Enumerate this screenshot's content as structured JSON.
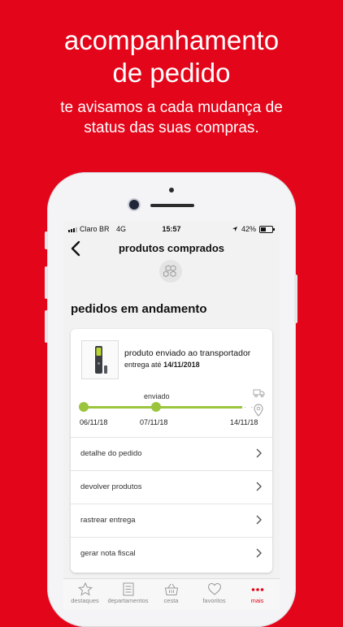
{
  "promo": {
    "headline_line1": "acompanhamento",
    "headline_line2": "de pedido",
    "sub_line1": "te avisamos a cada mudança de",
    "sub_line2": "status das suas compras."
  },
  "statusbar": {
    "carrier": "Claro BR",
    "network": "4G",
    "time": "15:57",
    "battery": "42%"
  },
  "navbar": {
    "back_icon": "chevron-left-icon",
    "title": "produtos comprados",
    "header_icon": "boxes-icon"
  },
  "section": {
    "title": "pedidos em andamento"
  },
  "order": {
    "status": "produto enviado ao transportador",
    "eta_prefix": "entrega até",
    "eta_date": "14/11/2018",
    "timeline": {
      "current_label": "enviado",
      "dates": [
        "06/11/18",
        "07/11/18",
        "14/11/18"
      ],
      "accent_color": "#9bc53d"
    },
    "actions": [
      {
        "label": "detalhe do pedido"
      },
      {
        "label": "devolver produtos"
      },
      {
        "label": "rastrear entrega"
      },
      {
        "label": "gerar nota fiscal"
      }
    ]
  },
  "tabbar": {
    "items": [
      {
        "label": "destaques",
        "icon": "star-icon"
      },
      {
        "label": "departamentos",
        "icon": "list-icon"
      },
      {
        "label": "cesta",
        "icon": "basket-icon"
      },
      {
        "label": "favoritos",
        "icon": "heart-icon"
      },
      {
        "label": "mais",
        "icon": "more-dots-icon"
      }
    ],
    "active_color": "#e3051a"
  },
  "colors": {
    "brand_red": "#e3051a",
    "progress_green": "#9bc53d"
  }
}
